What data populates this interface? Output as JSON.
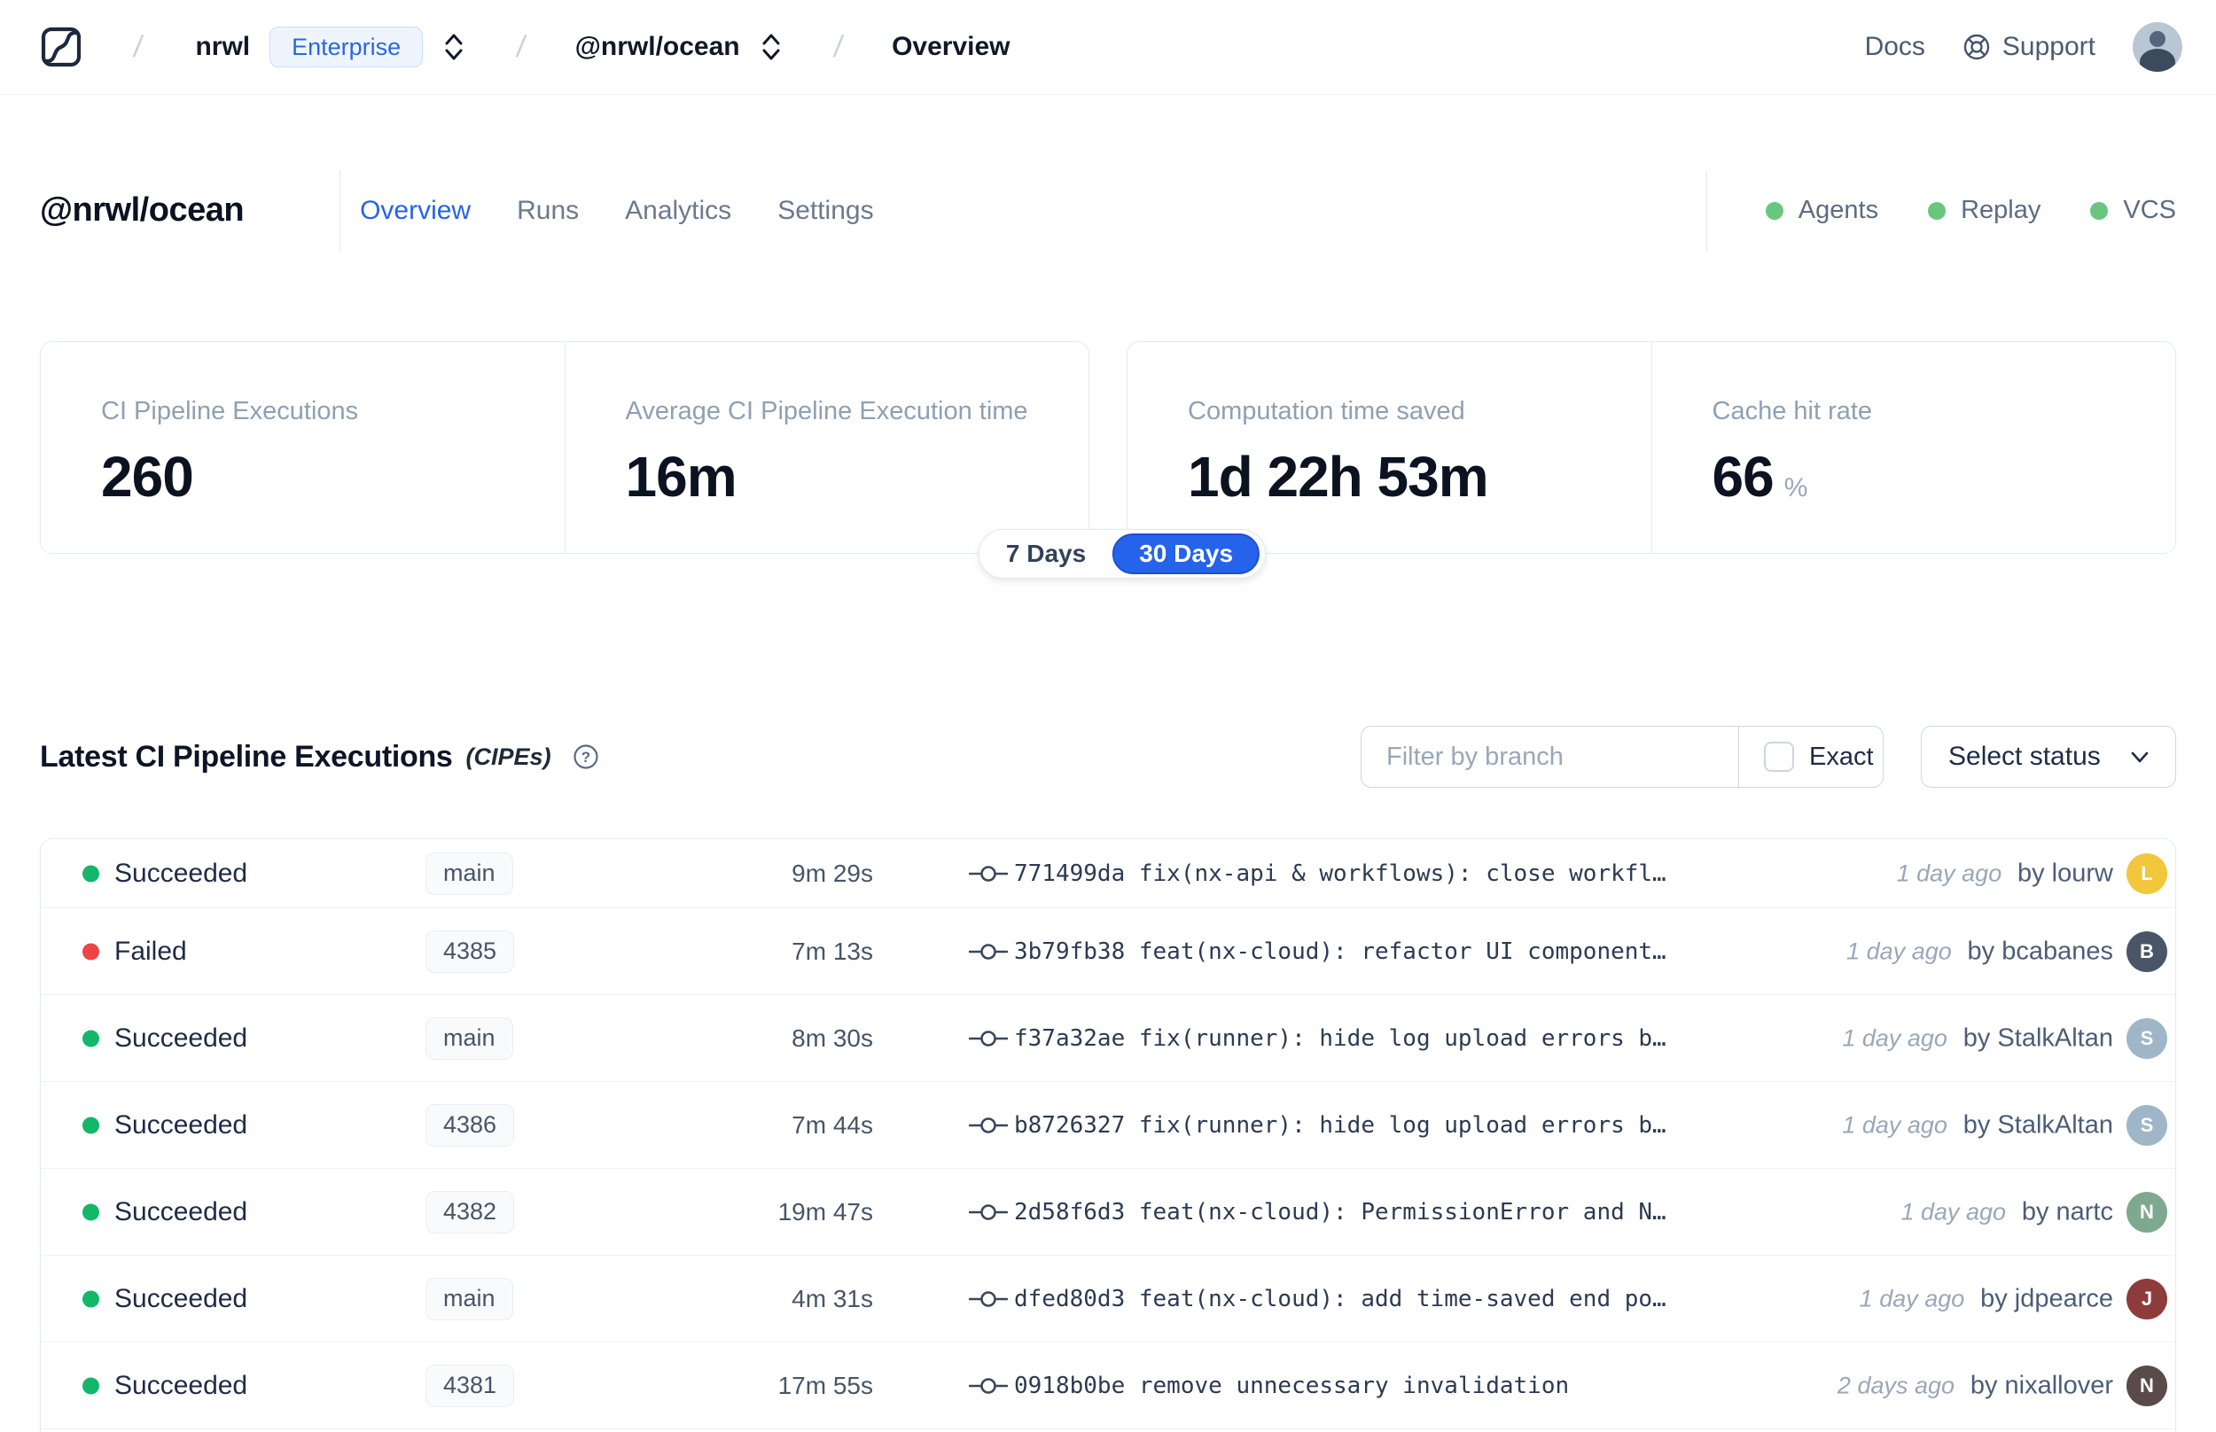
{
  "topbar": {
    "breadcrumb": {
      "separator": "/",
      "org": "nrwl",
      "plan_badge": "Enterprise",
      "workspace": "@nrwl/ocean",
      "page": "Overview"
    },
    "links": {
      "docs": "Docs",
      "support": "Support"
    }
  },
  "header": {
    "title": "@nrwl/ocean",
    "tabs": [
      {
        "label": "Overview",
        "active": true
      },
      {
        "label": "Runs",
        "active": false
      },
      {
        "label": "Analytics",
        "active": false
      },
      {
        "label": "Settings",
        "active": false
      }
    ],
    "statuses": [
      {
        "label": "Agents"
      },
      {
        "label": "Replay"
      },
      {
        "label": "VCS"
      }
    ],
    "status_dot_color": "#69c77d",
    "active_tab_color": "#2563eb"
  },
  "stats": {
    "cards": [
      {
        "label": "CI Pipeline Executions",
        "value": "260",
        "suffix": ""
      },
      {
        "label": "Average CI Pipeline Execution time",
        "value": "16m",
        "suffix": ""
      },
      {
        "label": "Computation time saved",
        "value": "1d 22h 53m",
        "suffix": ""
      },
      {
        "label": "Cache hit rate",
        "value": "66",
        "suffix": "%"
      }
    ],
    "range_toggle": {
      "options": [
        "7 Days",
        "30 Days"
      ],
      "selected": "30 Days",
      "selected_color": "#2563eb"
    }
  },
  "cipe_section": {
    "title": "Latest CI Pipeline Executions",
    "title_suffix": "(CIPEs)",
    "filter": {
      "placeholder": "Filter by branch",
      "exact_label": "Exact",
      "exact_checked": false
    },
    "status_select_label": "Select status"
  },
  "table": {
    "status_colors": {
      "Succeeded": "#12b76a",
      "Failed": "#ee4444"
    },
    "rows": [
      {
        "status": "Succeeded",
        "branch": "main",
        "duration": "9m 29s",
        "commit": "771499da fix(nx-api & workflows): close workfl…",
        "time_ago": "1 day ago",
        "author_line": "by lourw",
        "avatar_initial": "L",
        "avatar_color": "#f2c73c"
      },
      {
        "status": "Failed",
        "branch": "4385",
        "duration": "7m 13s",
        "commit": "3b79fb38 feat(nx-cloud): refactor UI component…",
        "time_ago": "1 day ago",
        "author_line": "by bcabanes",
        "avatar_initial": "B",
        "avatar_color": "#4a5568"
      },
      {
        "status": "Succeeded",
        "branch": "main",
        "duration": "8m 30s",
        "commit": "f37a32ae fix(runner): hide log upload errors b…",
        "time_ago": "1 day ago",
        "author_line": "by StalkAltan",
        "avatar_initial": "S",
        "avatar_color": "#9fb6c9"
      },
      {
        "status": "Succeeded",
        "branch": "4386",
        "duration": "7m 44s",
        "commit": "b8726327 fix(runner): hide log upload errors b…",
        "time_ago": "1 day ago",
        "author_line": "by StalkAltan",
        "avatar_initial": "S",
        "avatar_color": "#9fb6c9"
      },
      {
        "status": "Succeeded",
        "branch": "4382",
        "duration": "19m 47s",
        "commit": "2d58f6d3 feat(nx-cloud): PermissionError and N…",
        "time_ago": "1 day ago",
        "author_line": "by nartc",
        "avatar_initial": "N",
        "avatar_color": "#7fa98f"
      },
      {
        "status": "Succeeded",
        "branch": "main",
        "duration": "4m 31s",
        "commit": "dfed80d3 feat(nx-cloud): add time-saved end po…",
        "time_ago": "1 day ago",
        "author_line": "by jdpearce",
        "avatar_initial": "J",
        "avatar_color": "#8d3b3b"
      },
      {
        "status": "Succeeded",
        "branch": "4381",
        "duration": "17m 55s",
        "commit": "0918b0be remove unnecessary invalidation",
        "time_ago": "2 days ago",
        "author_line": "by nixallover",
        "avatar_initial": "N",
        "avatar_color": "#5a4a4a"
      }
    ]
  }
}
